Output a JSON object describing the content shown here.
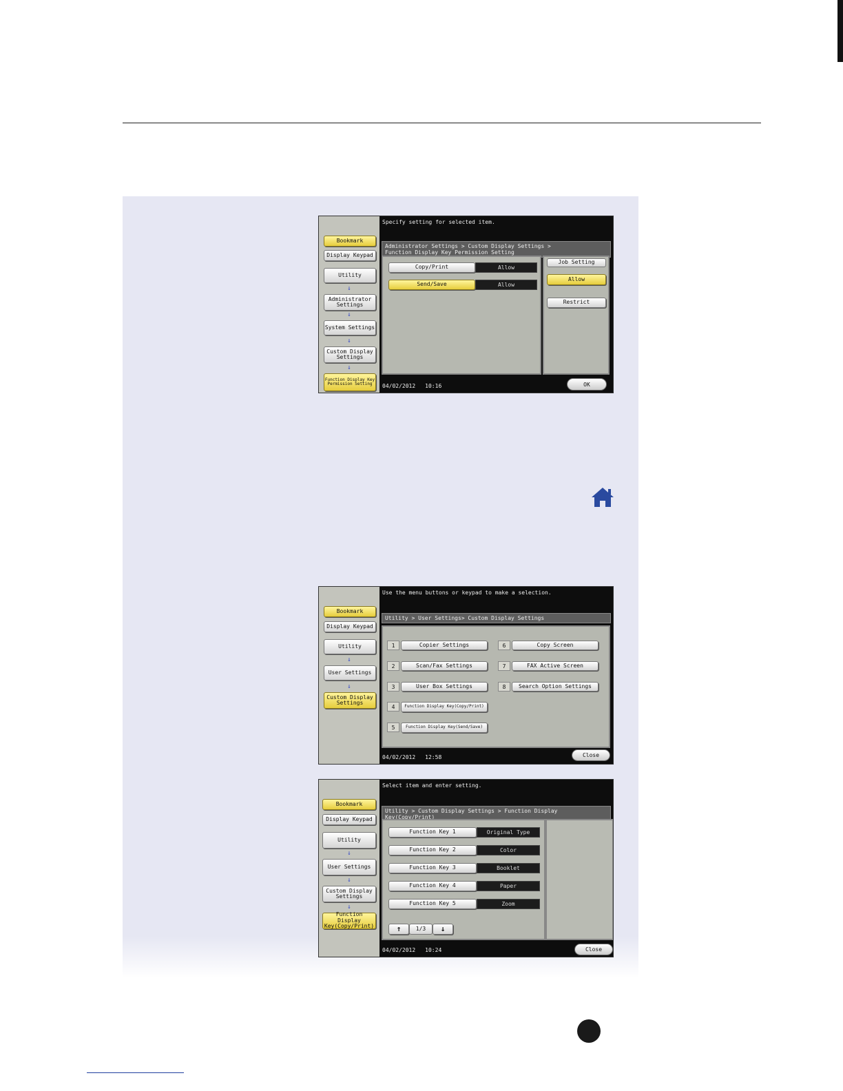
{
  "screen1": {
    "message": "Specify setting for selected item.",
    "breadcrumb": [
      "Administrator Settings > Custom Display Settings >",
      "Function Display Key Permission Setting"
    ],
    "sidebar": {
      "bookmark": "Bookmark",
      "display_keypad": "Display Keypad",
      "items": [
        "Utility",
        "Administrator Settings",
        "System Settings",
        "Custom Display Settings",
        "Function Display Key Permission Setting"
      ]
    },
    "rows": [
      {
        "label": "Copy/Print",
        "value": "Allow"
      },
      {
        "label": "Send/Save",
        "value": "Allow"
      }
    ],
    "job_setting": "Job Setting",
    "allow": "Allow",
    "restrict": "Restrict",
    "date": "04/02/2012",
    "time": "10:16",
    "ok": "OK"
  },
  "screen2": {
    "message": "Use the menu buttons or keypad to make a selection.",
    "breadcrumb": "Utility > User Settings> Custom Display Settings",
    "sidebar": {
      "bookmark": "Bookmark",
      "display_keypad": "Display Keypad",
      "items": [
        "Utility",
        "User Settings",
        "Custom Display Settings"
      ]
    },
    "menu": [
      {
        "num": "1",
        "label": "Copier Settings"
      },
      {
        "num": "2",
        "label": "Scan/Fax Settings"
      },
      {
        "num": "3",
        "label": "User Box Settings"
      },
      {
        "num": "4",
        "label": "Function Display Key(Copy/Print)"
      },
      {
        "num": "5",
        "label": "Function Display Key(Send/Save)"
      },
      {
        "num": "6",
        "label": "Copy Screen"
      },
      {
        "num": "7",
        "label": "FAX Active Screen"
      },
      {
        "num": "8",
        "label": "Search Option Settings"
      }
    ],
    "date": "04/02/2012",
    "time": "12:58",
    "close": "Close"
  },
  "screen3": {
    "message": "Select item and enter setting.",
    "breadcrumb": "Utility > Custom Display Settings > Function Display Key(Copy/Print)",
    "sidebar": {
      "bookmark": "Bookmark",
      "display_keypad": "Display Keypad",
      "items": [
        "Utility",
        "User Settings",
        "Custom Display Settings",
        "Function Display Key(Copy/Print)"
      ]
    },
    "keys": [
      {
        "label": "Function Key 1",
        "value": "Original Type"
      },
      {
        "label": "Function Key 2",
        "value": "Color"
      },
      {
        "label": "Function Key 3",
        "value": "Booklet"
      },
      {
        "label": "Function Key 4",
        "value": "Paper"
      },
      {
        "label": "Function Key 5",
        "value": "Zoom"
      }
    ],
    "page": "1/3",
    "date": "04/02/2012",
    "time": "10:24",
    "close": "Close"
  },
  "colors": {
    "panel": "#e6e7f3",
    "button_yellow": "#f2de5e",
    "home_icon": "#2a4a9f",
    "arrow": "#3245c7"
  },
  "icons": [
    "home-icon",
    "arrow-down-icon",
    "arrow-up-icon"
  ]
}
